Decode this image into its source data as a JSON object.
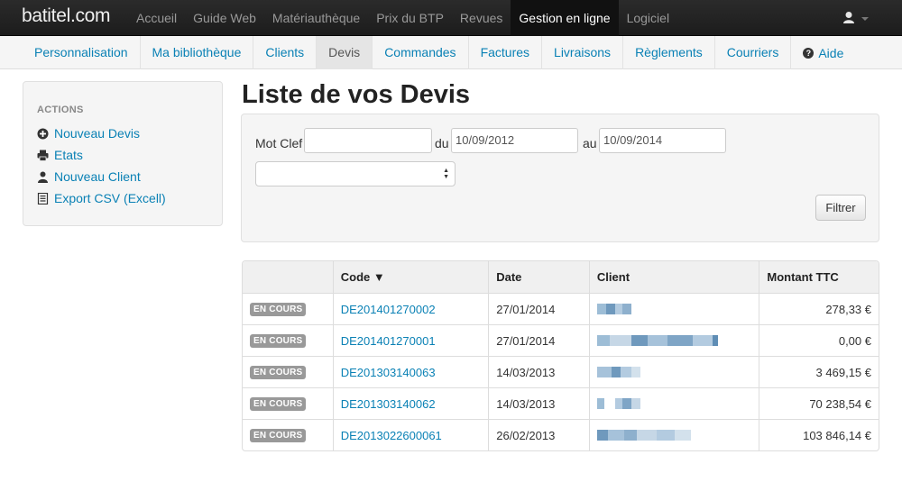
{
  "brand": "batitel.com",
  "top_nav": [
    {
      "label": "Accueil",
      "active": false
    },
    {
      "label": "Guide Web",
      "active": false
    },
    {
      "label": "Matériauthèque",
      "active": false
    },
    {
      "label": "Prix du BTP",
      "active": false
    },
    {
      "label": "Revues",
      "active": false
    },
    {
      "label": "Gestion en ligne",
      "active": true
    },
    {
      "label": "Logiciel",
      "active": false
    }
  ],
  "sub_nav": [
    {
      "label": "Personnalisation",
      "active": false
    },
    {
      "label": "Ma bibliothèque",
      "active": false
    },
    {
      "label": "Clients",
      "active": false
    },
    {
      "label": "Devis",
      "active": true
    },
    {
      "label": "Commandes",
      "active": false
    },
    {
      "label": "Factures",
      "active": false
    },
    {
      "label": "Livraisons",
      "active": false
    },
    {
      "label": "Règlements",
      "active": false
    },
    {
      "label": "Courriers",
      "active": false
    }
  ],
  "help_label": "Aide",
  "sidebar": {
    "heading": "ACTIONS",
    "items": [
      {
        "label": "Nouveau Devis",
        "icon": "plus-circle-icon"
      },
      {
        "label": "Etats",
        "icon": "printer-icon"
      },
      {
        "label": "Nouveau Client",
        "icon": "user-icon"
      },
      {
        "label": "Export CSV (Excell)",
        "icon": "list-document-icon"
      }
    ]
  },
  "page_title": "Liste de vos Devis",
  "filter": {
    "keyword_label": "Mot Clef",
    "keyword_value": "",
    "from_label": "du",
    "from_value": "10/09/2012",
    "to_label": "au",
    "to_value": "10/09/2014",
    "select_value": "",
    "button_label": "Filtrer"
  },
  "table": {
    "headers": [
      "",
      "Code ▼",
      "Date",
      "Client",
      "Montant TTC"
    ],
    "rows": [
      {
        "status": "EN COURS",
        "code": "DE201401270002",
        "date": "27/01/2014",
        "amount": "278,33 €"
      },
      {
        "status": "EN COURS",
        "code": "DE201401270001",
        "date": "27/01/2014",
        "amount": "0,00 €"
      },
      {
        "status": "EN COURS",
        "code": "DE201303140063",
        "date": "14/03/2013",
        "amount": "3 469,15 €"
      },
      {
        "status": "EN COURS",
        "code": "DE201303140062",
        "date": "14/03/2013",
        "amount": "70 238,54 €"
      },
      {
        "status": "EN COURS",
        "code": "DE2013022600061",
        "date": "26/02/2013",
        "amount": "103 846,14 €"
      }
    ]
  },
  "colors": {
    "link": "#0a81b5",
    "navbar": "#222222",
    "badge": "#999999"
  }
}
